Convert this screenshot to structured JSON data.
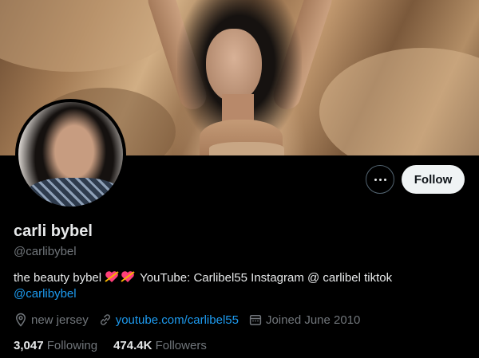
{
  "profile": {
    "display_name": "carli bybel",
    "handle": "@carlibybel",
    "bio_text": "the beauty bybel",
    "bio_emojis": [
      "heart-with-arrow-emoji",
      "heart-with-arrow-emoji"
    ],
    "bio_text_2": "YouTube: Carlibel55 Instagram @ carlibel tiktok",
    "bio_link": "@carlibybel",
    "location": "new jersey",
    "website": "youtube.com/carlibel55",
    "joined": "Joined June 2010",
    "following_count": "3,047",
    "following_label": "Following",
    "followers_count": "474.4K",
    "followers_label": "Followers"
  },
  "actions": {
    "follow_label": "Follow",
    "more_icon": "more-icon"
  },
  "colors": {
    "background": "#000000",
    "link": "#1d9bf0",
    "secondary_text": "#71767b",
    "primary_text": "#e7e9ea",
    "follow_button_bg": "#eff3f4"
  }
}
